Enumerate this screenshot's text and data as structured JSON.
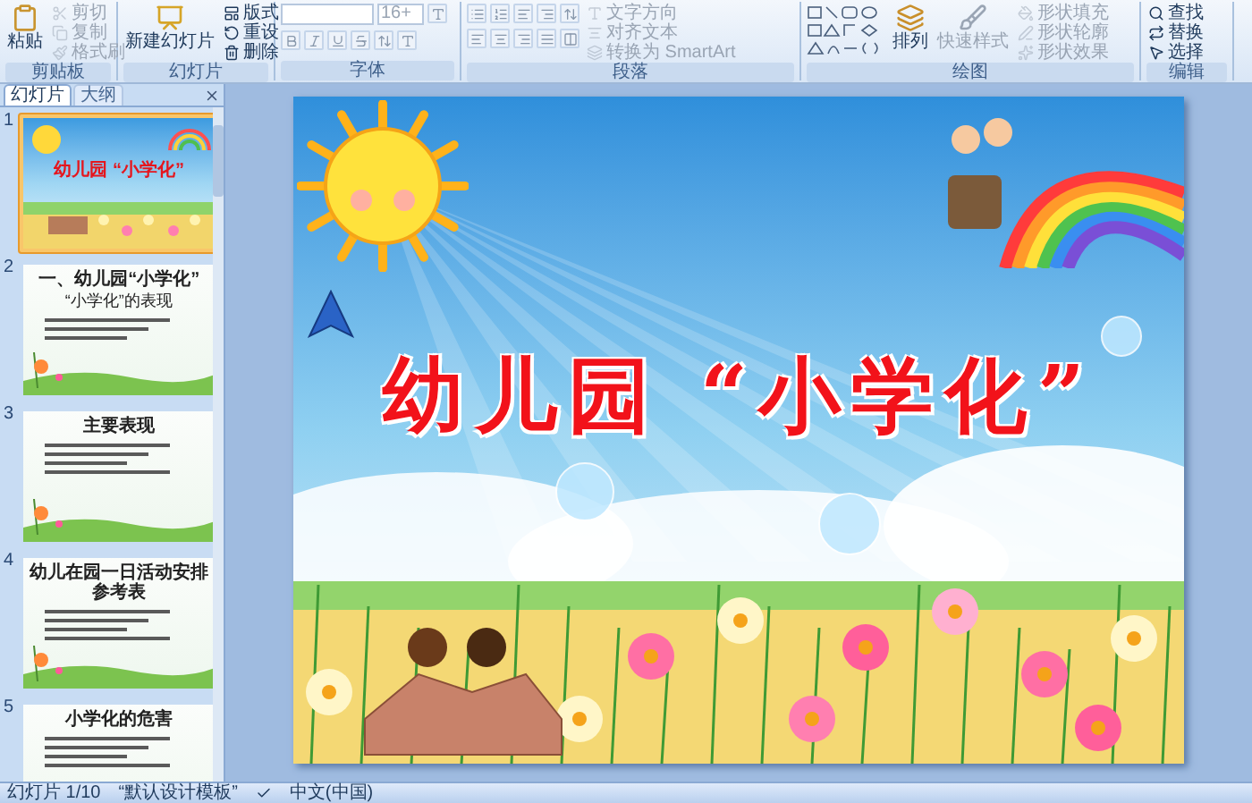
{
  "ribbon": {
    "groups": [
      {
        "label": "剪贴板",
        "items": [
          {
            "label": "粘贴",
            "disabled": false
          },
          {
            "label": "剪切",
            "disabled": true
          },
          {
            "label": "复制",
            "disabled": true
          },
          {
            "label": "格式刷",
            "disabled": true
          }
        ]
      },
      {
        "label": "幻灯片",
        "items": [
          {
            "label": "新建幻灯片",
            "disabled": false
          },
          {
            "label": "版式",
            "disabled": false
          },
          {
            "label": "重设",
            "disabled": false
          },
          {
            "label": "删除",
            "disabled": false
          }
        ]
      },
      {
        "label": "字体",
        "items": [
          {
            "value": "16+",
            "disabled": true
          }
        ]
      },
      {
        "label": "段落",
        "items": [
          {
            "label": "文字方向",
            "disabled": true
          },
          {
            "label": "对齐文本",
            "disabled": true
          },
          {
            "label": "转换为 SmartArt",
            "disabled": true
          }
        ]
      },
      {
        "label": "绘图",
        "items": [
          {
            "label": "排列",
            "disabled": false
          },
          {
            "label": "快速样式",
            "disabled": true
          },
          {
            "label": "形状填充",
            "disabled": true
          },
          {
            "label": "形状轮廓",
            "disabled": true
          },
          {
            "label": "形状效果",
            "disabled": true
          }
        ]
      },
      {
        "label": "编辑",
        "items": [
          {
            "label": "查找",
            "disabled": false
          },
          {
            "label": "替换",
            "disabled": false
          },
          {
            "label": "选择",
            "disabled": false
          }
        ]
      }
    ]
  },
  "panel": {
    "tabs": [
      {
        "label": "幻灯片",
        "selected": true
      },
      {
        "label": "大纲",
        "selected": false
      }
    ],
    "thumbnails": [
      {
        "number": "1",
        "selected": true,
        "kind": "title",
        "title": "幼儿园 “小学化”"
      },
      {
        "number": "2",
        "selected": false,
        "kind": "content",
        "title": "一、幼儿园“小学化”",
        "subtitle": "“小学化”的表现"
      },
      {
        "number": "3",
        "selected": false,
        "kind": "content",
        "title": "主要表现"
      },
      {
        "number": "4",
        "selected": false,
        "kind": "content",
        "title": "幼儿在园一日活动安排参考表"
      },
      {
        "number": "5",
        "selected": false,
        "kind": "content",
        "title": "小学化的危害"
      }
    ]
  },
  "slide": {
    "title": "幼儿园 “小学化”"
  },
  "status_bar": {
    "slide": "幻灯片 1/10",
    "theme": "“默认设计模板”",
    "language": "中文(中国)"
  }
}
